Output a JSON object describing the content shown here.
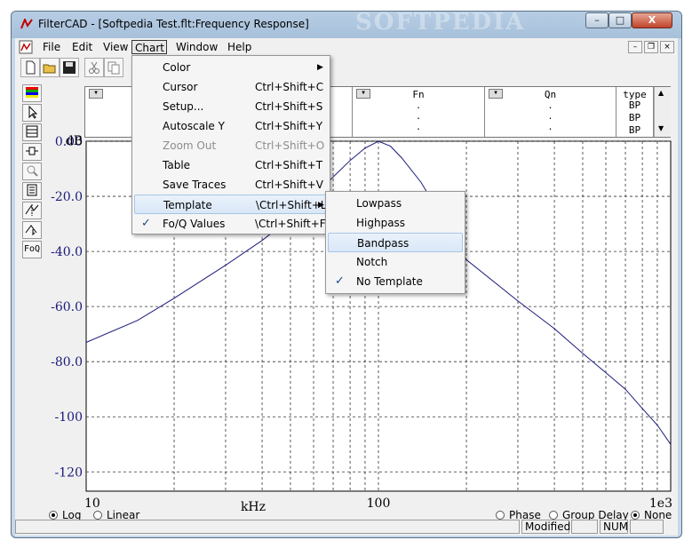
{
  "window": {
    "title": "FilterCAD - [Softpedia Test.flt:Frequency Response]",
    "controls": {
      "minimize": "–",
      "maximize": "□",
      "close": "X"
    }
  },
  "menubar": [
    "File",
    "Edit",
    "View",
    "Chart",
    "Window",
    "Help"
  ],
  "mdi_controls": {
    "minimize": "–",
    "restore": "❐",
    "close": "×"
  },
  "left_tools": [
    "FoQ"
  ],
  "table": {
    "columns": [
      {
        "header": "",
        "rows": [
          "1",
          "1"
        ]
      },
      {
        "header": "Fn",
        "rows": [
          ".",
          ".",
          "."
        ]
      },
      {
        "header": "Qn",
        "rows": [
          ".",
          ".",
          "."
        ]
      },
      {
        "header": "type",
        "rows": [
          "BP",
          "BP",
          "BP"
        ]
      }
    ]
  },
  "chart_menu": {
    "items": [
      {
        "label": "Color",
        "shortcut": "",
        "submenu": true
      },
      {
        "label": "Cursor",
        "shortcut": "Ctrl+Shift+C"
      },
      {
        "label": "Setup...",
        "shortcut": "Ctrl+Shift+S"
      },
      {
        "label": "Autoscale Y",
        "shortcut": "Ctrl+Shift+Y"
      },
      {
        "label": "Zoom Out",
        "shortcut": "Ctrl+Shift+O",
        "disabled": true
      },
      {
        "label": "Table",
        "shortcut": "Ctrl+Shift+T"
      },
      {
        "label": "Save Traces",
        "shortcut": "Ctrl+Shift+V"
      },
      {
        "label": "Template",
        "shortcut": "\\Ctrl+Shift+L",
        "submenu": true,
        "highlighted": true
      },
      {
        "label": "Fo/Q Values",
        "shortcut": "\\Ctrl+Shift+F",
        "checked": true
      }
    ]
  },
  "template_menu": {
    "items": [
      {
        "label": "Lowpass"
      },
      {
        "label": "Highpass"
      },
      {
        "label": "Bandpass",
        "highlighted": true
      },
      {
        "label": "Notch"
      },
      {
        "label": "No Template",
        "checked": true
      }
    ]
  },
  "chart_data": {
    "type": "line",
    "title": "",
    "ylabel": "dB",
    "xlabel": "kHz",
    "x_scale": "log",
    "xlim": [
      10,
      1000
    ],
    "ylim": [
      -127,
      0
    ],
    "y_ticks": [
      0,
      -20,
      -40,
      -60,
      -80,
      -100,
      -120
    ],
    "y_tick_labels": [
      "0.00",
      "-20.0",
      "-40.0",
      "-60.0",
      "-80.0",
      "-100",
      "-120"
    ],
    "x_tick_labels": [
      {
        "value": 10,
        "label": "10"
      },
      {
        "value": 100,
        "label": "100"
      },
      {
        "value": 1000,
        "label": "1e3"
      }
    ],
    "grid": true,
    "line_color": "#1a1a7a",
    "series": [
      {
        "points": [
          [
            10,
            -73
          ],
          [
            15,
            -65
          ],
          [
            20,
            -57
          ],
          [
            30,
            -45
          ],
          [
            40,
            -36
          ],
          [
            50,
            -28
          ],
          [
            60,
            -20
          ],
          [
            70,
            -13
          ],
          [
            80,
            -7
          ],
          [
            90,
            -2.5
          ],
          [
            100,
            0
          ],
          [
            110,
            -1.8
          ],
          [
            120,
            -6
          ],
          [
            140,
            -15
          ],
          [
            170,
            -30
          ],
          [
            200,
            -43
          ],
          [
            300,
            -58
          ],
          [
            400,
            -68
          ],
          [
            500,
            -77
          ],
          [
            600,
            -84
          ],
          [
            700,
            -90
          ],
          [
            800,
            -97
          ],
          [
            900,
            -103
          ],
          [
            1000,
            -110
          ]
        ]
      }
    ]
  },
  "bottom_controls": {
    "scale": [
      {
        "label": "Log",
        "selected": true
      },
      {
        "label": "Linear",
        "selected": false
      }
    ],
    "mode": [
      {
        "label": "Phase",
        "selected": false
      },
      {
        "label": "Group Delay",
        "selected": false
      },
      {
        "label": "None",
        "selected": true
      }
    ]
  },
  "status": {
    "modified": "Modified",
    "num": "NUM"
  },
  "watermark": "SOFTPEDIA"
}
